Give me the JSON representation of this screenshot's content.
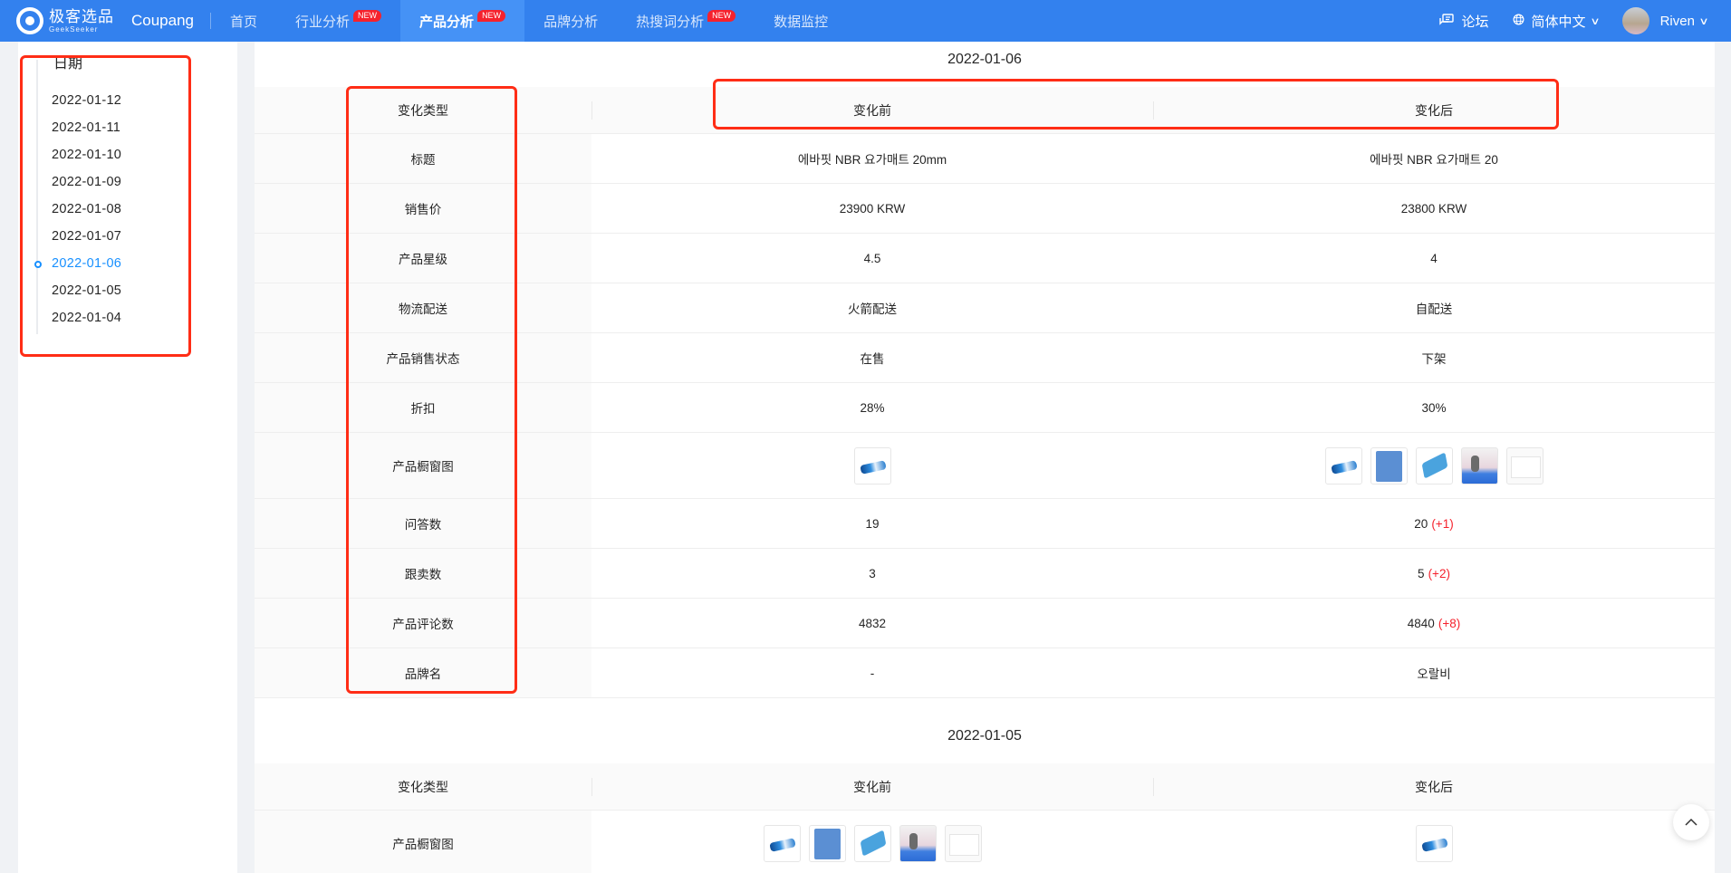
{
  "header": {
    "logo_cn": "极客选品",
    "logo_en": "GeekSeeker",
    "platform": "Coupang",
    "nav": [
      {
        "label": "首页",
        "badge": ""
      },
      {
        "label": "行业分析",
        "badge": "NEW"
      },
      {
        "label": "产品分析",
        "badge": "NEW",
        "active": true
      },
      {
        "label": "品牌分析",
        "badge": ""
      },
      {
        "label": "热搜词分析",
        "badge": "NEW"
      },
      {
        "label": "数据监控",
        "badge": ""
      }
    ],
    "forum_label": "论坛",
    "language_label": "简体中文",
    "user_name": "Riven",
    "icons": {
      "forum": "chat-icon",
      "language": "globe-icon",
      "chevron": "chevron-down-icon"
    }
  },
  "sidebar": {
    "title": "日期",
    "dates": [
      "2022-01-12",
      "2022-01-11",
      "2022-01-10",
      "2022-01-09",
      "2022-01-08",
      "2022-01-07",
      "2022-01-06",
      "2022-01-05",
      "2022-01-04"
    ],
    "active_index": 6
  },
  "sections": [
    {
      "date": "2022-01-06",
      "columns": [
        "变化类型",
        "变化前",
        "变化后"
      ],
      "rows": [
        {
          "type": "标题",
          "before": "에바핏 NBR 요가매트 20mm",
          "after": "에바핏 NBR 요가매트 20",
          "diff": ""
        },
        {
          "type": "销售价",
          "before": "23900 KRW",
          "after": "23800 KRW",
          "diff": ""
        },
        {
          "type": "产品星级",
          "before": "4.5",
          "after": "4",
          "diff": ""
        },
        {
          "type": "物流配送",
          "before": "火箭配送",
          "after": "自配送",
          "diff": ""
        },
        {
          "type": "产品销售状态",
          "before": "在售",
          "after": "下架",
          "diff": ""
        },
        {
          "type": "折扣",
          "before": "28%",
          "after": "30%",
          "diff": ""
        },
        {
          "type": "产品橱窗图",
          "images_before": [
            "roll"
          ],
          "images_after": [
            "roll",
            "mat",
            "fold",
            "scene",
            "blank"
          ]
        },
        {
          "type": "问答数",
          "before": "19",
          "after": "20",
          "diff": "(+1)"
        },
        {
          "type": "跟卖数",
          "before": "3",
          "after": "5",
          "diff": "(+2)"
        },
        {
          "type": "产品评论数",
          "before": "4832",
          "after": "4840",
          "diff": "(+8)"
        },
        {
          "type": "品牌名",
          "before": "-",
          "after": "오랄비",
          "diff": ""
        }
      ]
    },
    {
      "date": "2022-01-05",
      "columns": [
        "变化类型",
        "变化前",
        "变化后"
      ],
      "rows": [
        {
          "type": "产品橱窗图",
          "images_before": [
            "roll",
            "mat",
            "fold",
            "scene",
            "blank"
          ],
          "images_after": [
            "roll"
          ]
        }
      ]
    }
  ],
  "back_to_top": "^",
  "colors": {
    "header_bg": "#3381ee",
    "active_nav": "#4592f6",
    "accent": "#1890ff",
    "diff_red": "#f5222d",
    "annotation_red": "#ff2d16"
  }
}
